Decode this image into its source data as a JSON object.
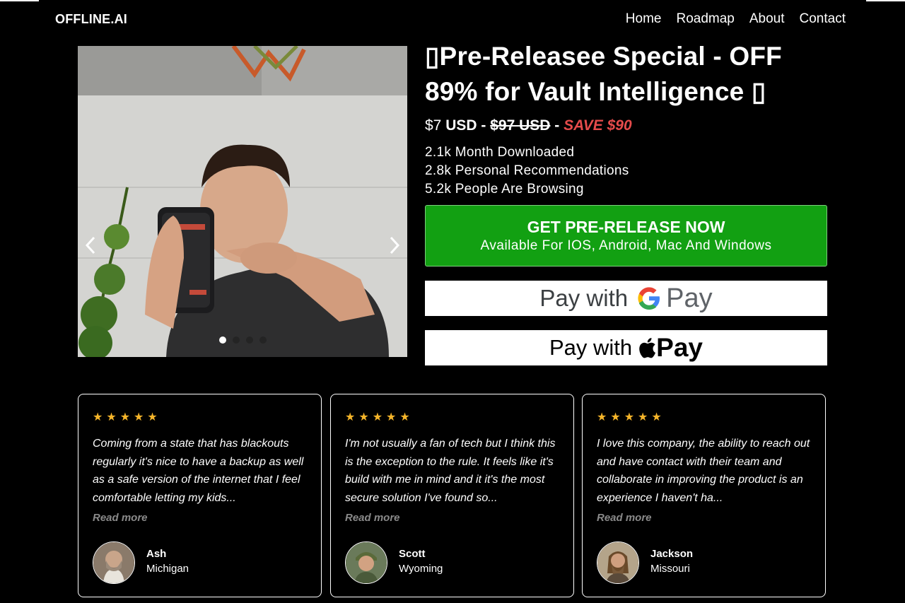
{
  "nav": {
    "brand": "OFFLINE.AI",
    "links": [
      "Home",
      "Roadmap",
      "About",
      "Contact"
    ]
  },
  "carousel": {
    "prev_icon": "chevron-left-icon",
    "next_icon": "chevron-right-icon",
    "slide_count": 4,
    "active_index": 0
  },
  "product": {
    "title": "▯Pre-Releasee Special - OFF 89% for Vault Intelligence ▯",
    "price_new": "$7",
    "price_new_currency": "USD",
    "separator": "-",
    "price_old": "$97 USD",
    "save": "SAVE $90",
    "stats": [
      "2.1k Month Downloaded",
      "2.8k Personal Recommendations",
      "5.2k People Are Browsing"
    ]
  },
  "cta": {
    "line1": "GET PRE-RELEASE NOW",
    "line2": "Available For IOS, Android, Mac And Windows"
  },
  "payments": {
    "google": {
      "prefix": "Pay with",
      "suffix": "Pay"
    },
    "apple": {
      "prefix": "Pay with",
      "suffix": "Pay"
    }
  },
  "reviews": [
    {
      "stars": "★★★★★",
      "text": "Coming from a state that has blackouts regularly it's nice to have a backup as well as a safe version of the internet that I feel comfortable letting my kids...",
      "read_more": "Read more",
      "name": "Ash",
      "location": "Michigan"
    },
    {
      "stars": "★★★★★",
      "text": "I'm not usually a fan of tech but I think this is the exception to the rule. It feels like it's build with me in mind and it it's the most secure solution I've found so...",
      "read_more": "Read more",
      "name": "Scott",
      "location": "Wyoming"
    },
    {
      "stars": "★★★★★",
      "text": "I love this company, the ability to reach out and have contact with their team and collaborate in improving the product is an experience I haven't ha...",
      "read_more": "Read more",
      "name": "Jackson",
      "location": "Missouri"
    }
  ],
  "colors": {
    "cta_green": "#12a012",
    "save_red": "#e54b4b",
    "star_gold": "#f5b52a"
  }
}
